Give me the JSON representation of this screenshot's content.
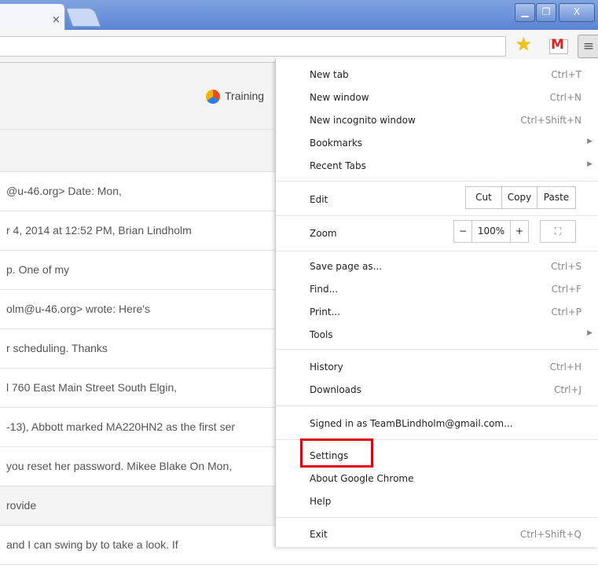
{
  "tab": {
    "close_glyph": "×"
  },
  "window": {
    "min": "▁",
    "restore": "❐",
    "close": "X"
  },
  "toolbar": {
    "star": "★",
    "gmail": "M",
    "menu": "≡"
  },
  "page": {
    "header_link": "Training",
    "rows": [
      "@u-46.org> Date: Mon,",
      "r 4, 2014 at 12:52 PM, Brian Lindholm",
      "p. One of my",
      "olm@u-46.org> wrote: Here's",
      "r scheduling. Thanks",
      "l 760 East Main Street South Elgin,",
      "-13), Abbott marked MA220HN2 as the first ser",
      "you reset her password. Mikee Blake On Mon,",
      "rovide",
      "and I can swing by to take a look. If"
    ]
  },
  "menu": {
    "new_tab": {
      "label": "New tab",
      "shortcut": "Ctrl+T"
    },
    "new_window": {
      "label": "New window",
      "shortcut": "Ctrl+N"
    },
    "new_incognito": {
      "label": "New incognito window",
      "shortcut": "Ctrl+Shift+N"
    },
    "bookmarks": {
      "label": "Bookmarks"
    },
    "recent_tabs": {
      "label": "Recent Tabs"
    },
    "edit": {
      "label": "Edit",
      "cut": "Cut",
      "copy": "Copy",
      "paste": "Paste"
    },
    "zoom": {
      "label": "Zoom",
      "minus": "−",
      "level": "100%",
      "plus": "+",
      "fullscreen": "⛶"
    },
    "save_page": {
      "label": "Save page as...",
      "shortcut": "Ctrl+S"
    },
    "find": {
      "label": "Find...",
      "shortcut": "Ctrl+F"
    },
    "print": {
      "label": "Print...",
      "shortcut": "Ctrl+P"
    },
    "tools": {
      "label": "Tools"
    },
    "history": {
      "label": "History",
      "shortcut": "Ctrl+H"
    },
    "downloads": {
      "label": "Downloads",
      "shortcut": "Ctrl+J"
    },
    "signed_in": {
      "label": "Signed in as TeamBLindholm@gmail.com..."
    },
    "settings": {
      "label": "Settings"
    },
    "about": {
      "label": "About Google Chrome"
    },
    "help": {
      "label": "Help"
    },
    "exit": {
      "label": "Exit",
      "shortcut": "Ctrl+Shift+Q"
    },
    "submenu_arrow": "▶"
  },
  "colors": {
    "highlight_box": "#e4000f",
    "title_bar": "#6b91d8"
  }
}
